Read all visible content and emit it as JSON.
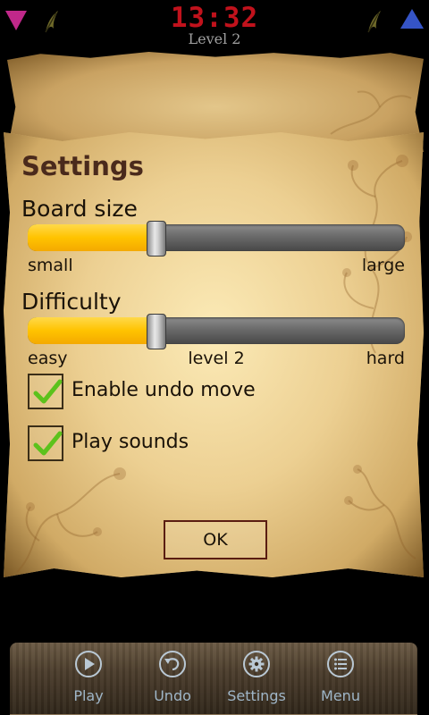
{
  "status": {
    "time": "13:32",
    "level": "Level 2"
  },
  "settings": {
    "title": "Settings",
    "board_size": {
      "label": "Board size",
      "min_label": "small",
      "max_label": "large",
      "value_fraction": 0.34
    },
    "difficulty": {
      "label": "Difficulty",
      "min_label": "easy",
      "mid_label": "level 2",
      "max_label": "hard",
      "value_fraction": 0.34
    },
    "options": [
      {
        "label": "Enable undo move",
        "checked": true
      },
      {
        "label": "Play sounds",
        "checked": true
      }
    ],
    "ok_label": "OK"
  },
  "toolbar": {
    "items": [
      {
        "label": "Play",
        "icon": "play-icon"
      },
      {
        "label": "Undo",
        "icon": "undo-icon"
      },
      {
        "label": "Settings",
        "icon": "gear-icon"
      },
      {
        "label": "Menu",
        "icon": "menu-icon"
      }
    ]
  },
  "colors": {
    "slider_fill": "#ffc300",
    "clock": "#c1121c",
    "toolbar_label": "#9fb6c8",
    "check": "#5cc21c"
  }
}
